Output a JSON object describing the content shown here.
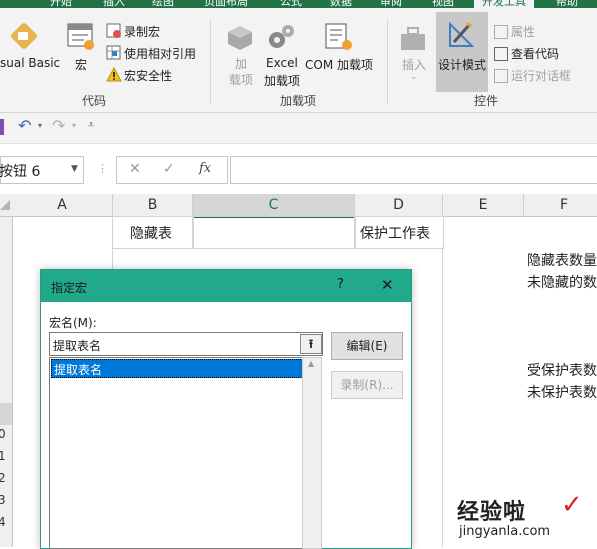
{
  "ribbon": {
    "tabs": [
      {
        "label": "开始"
      },
      {
        "label": "插入"
      },
      {
        "label": "绘图"
      },
      {
        "label": "页面布局"
      },
      {
        "label": "公式"
      },
      {
        "label": "数据"
      },
      {
        "label": "审阅"
      },
      {
        "label": "视图"
      },
      {
        "label": "开发工具"
      },
      {
        "label": "帮助"
      }
    ],
    "code_group": {
      "label": "代码",
      "visual_basic": "sual Basic",
      "macros": "宏",
      "record_macro": "录制宏",
      "relative_refs": "使用相对引用",
      "macro_security": "宏安全性"
    },
    "addins_group": {
      "label": "加载项",
      "addins": "加\n载项",
      "excel_addins_1": "Excel",
      "excel_addins_2": "加载项",
      "com_addins": "COM 加载项"
    },
    "controls_group": {
      "label": "控件",
      "insert": "插入",
      "design_mode": "设计模式",
      "properties": "属性",
      "view_code": "查看代码",
      "run_dialog": "运行对话框"
    }
  },
  "formula_bar": {
    "name_box": "按钮 6",
    "fx": "fx",
    "cancel": "✕",
    "enter": "✓",
    "formula": ""
  },
  "sheet": {
    "columns": [
      "A",
      "B",
      "C",
      "D",
      "E",
      "F"
    ],
    "rows": [
      "0",
      "1",
      "2",
      "3",
      "4"
    ],
    "b1": "隐藏表",
    "d1": "保护工作表",
    "f_notes": [
      "隐藏表数量",
      "未隐藏的数",
      "受保护表数",
      "未保护表数"
    ]
  },
  "dialog": {
    "title": "指定宏",
    "help": "?",
    "close": "✕",
    "macro_name_label": "宏名(M):",
    "macro_name_value": "提取表名",
    "list_items": [
      "提取表名"
    ],
    "edit_button": "编辑(E)",
    "record_button": "录制(R)..."
  },
  "watermark": {
    "line1": "经验啦",
    "check": "✓",
    "line2": "jingyanla.com"
  },
  "colors": {
    "excel_green": "#217346",
    "dialog_title": "#20a98a",
    "selection_blue": "#0078d7"
  }
}
